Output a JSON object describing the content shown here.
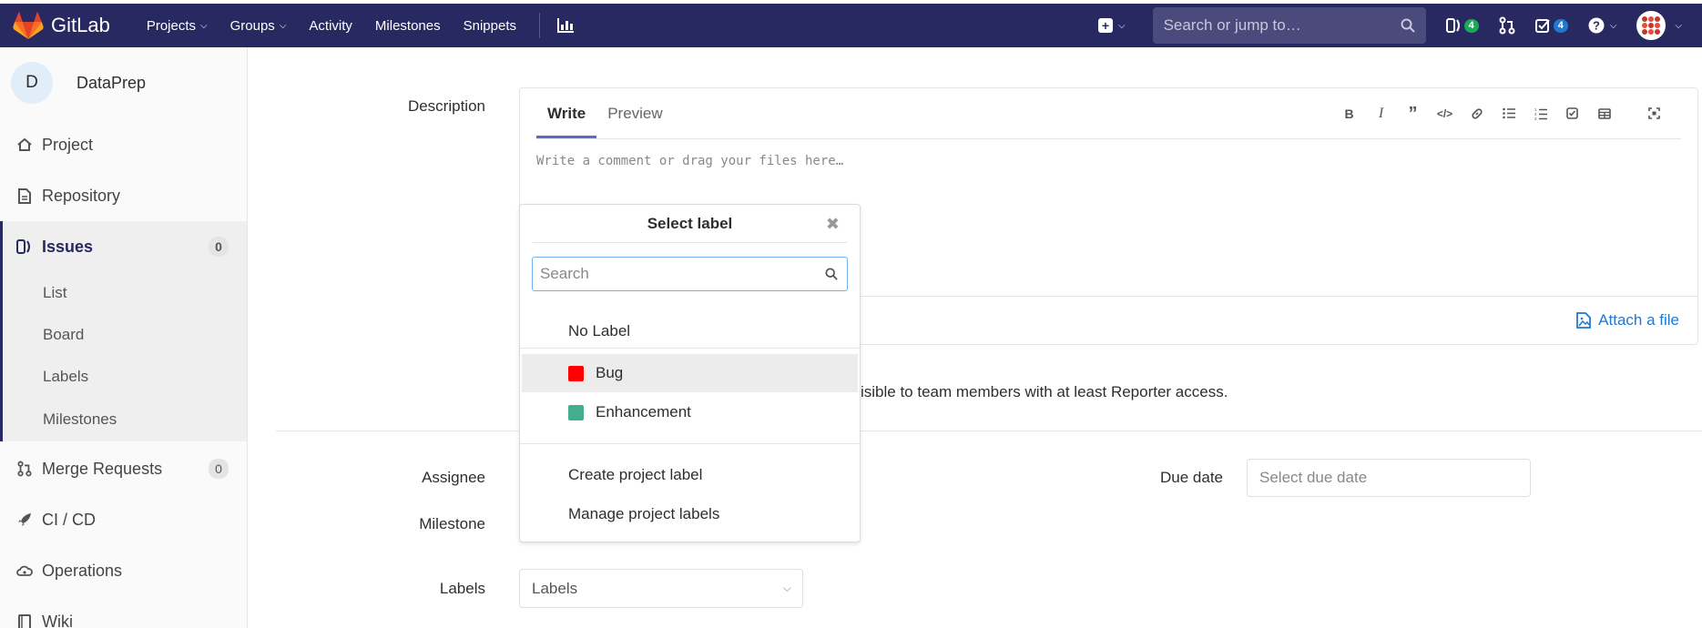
{
  "colors": {
    "navbar": "#292961",
    "accent": "#1f78d1",
    "bug_label": "#ff0000",
    "enhancement_label": "#44ad8e"
  },
  "navbar": {
    "brand": "GitLab",
    "links": [
      "Projects",
      "Groups",
      "Activity",
      "Milestones",
      "Snippets"
    ],
    "search_placeholder": "Search or jump to…",
    "issues_count": "4",
    "todos_count": "4"
  },
  "sidebar": {
    "project_initial": "D",
    "project_name": "DataPrep",
    "items": [
      {
        "label": "Project",
        "icon": "home-icon"
      },
      {
        "label": "Repository",
        "icon": "doc-icon"
      },
      {
        "label": "Issues",
        "icon": "issues-icon",
        "count": "0"
      },
      {
        "label": "Merge Requests",
        "icon": "merge-request-icon",
        "count": "0"
      },
      {
        "label": "CI / CD",
        "icon": "rocket-icon"
      },
      {
        "label": "Operations",
        "icon": "cloud-gear-icon"
      },
      {
        "label": "Wiki",
        "icon": "book-icon"
      }
    ],
    "issues_subitems": [
      "List",
      "Board",
      "Labels",
      "Milestones"
    ]
  },
  "form": {
    "description_label": "Description",
    "tab_write": "Write",
    "tab_preview": "Preview",
    "editor_placeholder": "Write a comment or drag your files here…",
    "attach_label": "Attach a file",
    "confidential_text": "isible to team members with at least Reporter access.",
    "assignee_label": "Assignee",
    "milestone_label": "Milestone",
    "labels_label": "Labels",
    "labels_placeholder": "Labels",
    "due_date_label": "Due date",
    "due_date_placeholder": "Select due date"
  },
  "label_dropdown": {
    "title": "Select label",
    "search_placeholder": "Search",
    "no_label": "No Label",
    "labels": [
      {
        "name": "Bug",
        "color": "#ff0000"
      },
      {
        "name": "Enhancement",
        "color": "#44ad8e"
      }
    ],
    "create_label": "Create project label",
    "manage_labels": "Manage project labels"
  }
}
